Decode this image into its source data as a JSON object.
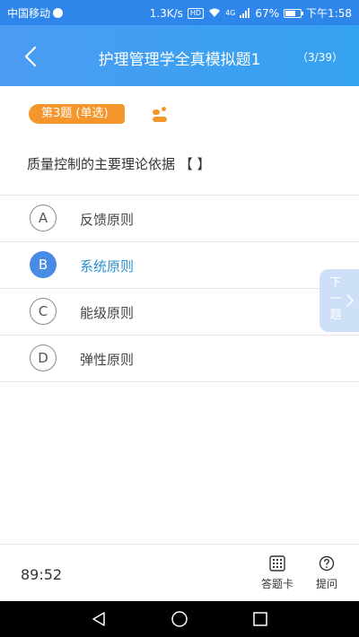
{
  "status_bar": {
    "carrier": "中国移动",
    "speed": "1.3K/s",
    "hd": "HD",
    "network": "4G",
    "battery": "67%",
    "time": "下午1:58"
  },
  "header": {
    "title": "护理管理学全真模拟题1",
    "progress": "（3/39）"
  },
  "question": {
    "tag": "第3题 (单选)",
    "text": "质量控制的主要理论依据 【 】",
    "options": [
      {
        "letter": "A",
        "text": "反馈原则",
        "selected": false
      },
      {
        "letter": "B",
        "text": "系统原则",
        "selected": true
      },
      {
        "letter": "C",
        "text": "能级原则",
        "selected": false
      },
      {
        "letter": "D",
        "text": "弹性原则",
        "selected": false
      }
    ]
  },
  "next_tab": {
    "label_1": "下",
    "label_2": "一",
    "label_3": "题"
  },
  "bottom_bar": {
    "timer": "89:52",
    "answer_card_label": "答题卡",
    "ask_label": "提问"
  },
  "colors": {
    "accent": "#4a8be6",
    "tag_orange": "#f5962d",
    "selected_text": "#2b8fcf"
  }
}
